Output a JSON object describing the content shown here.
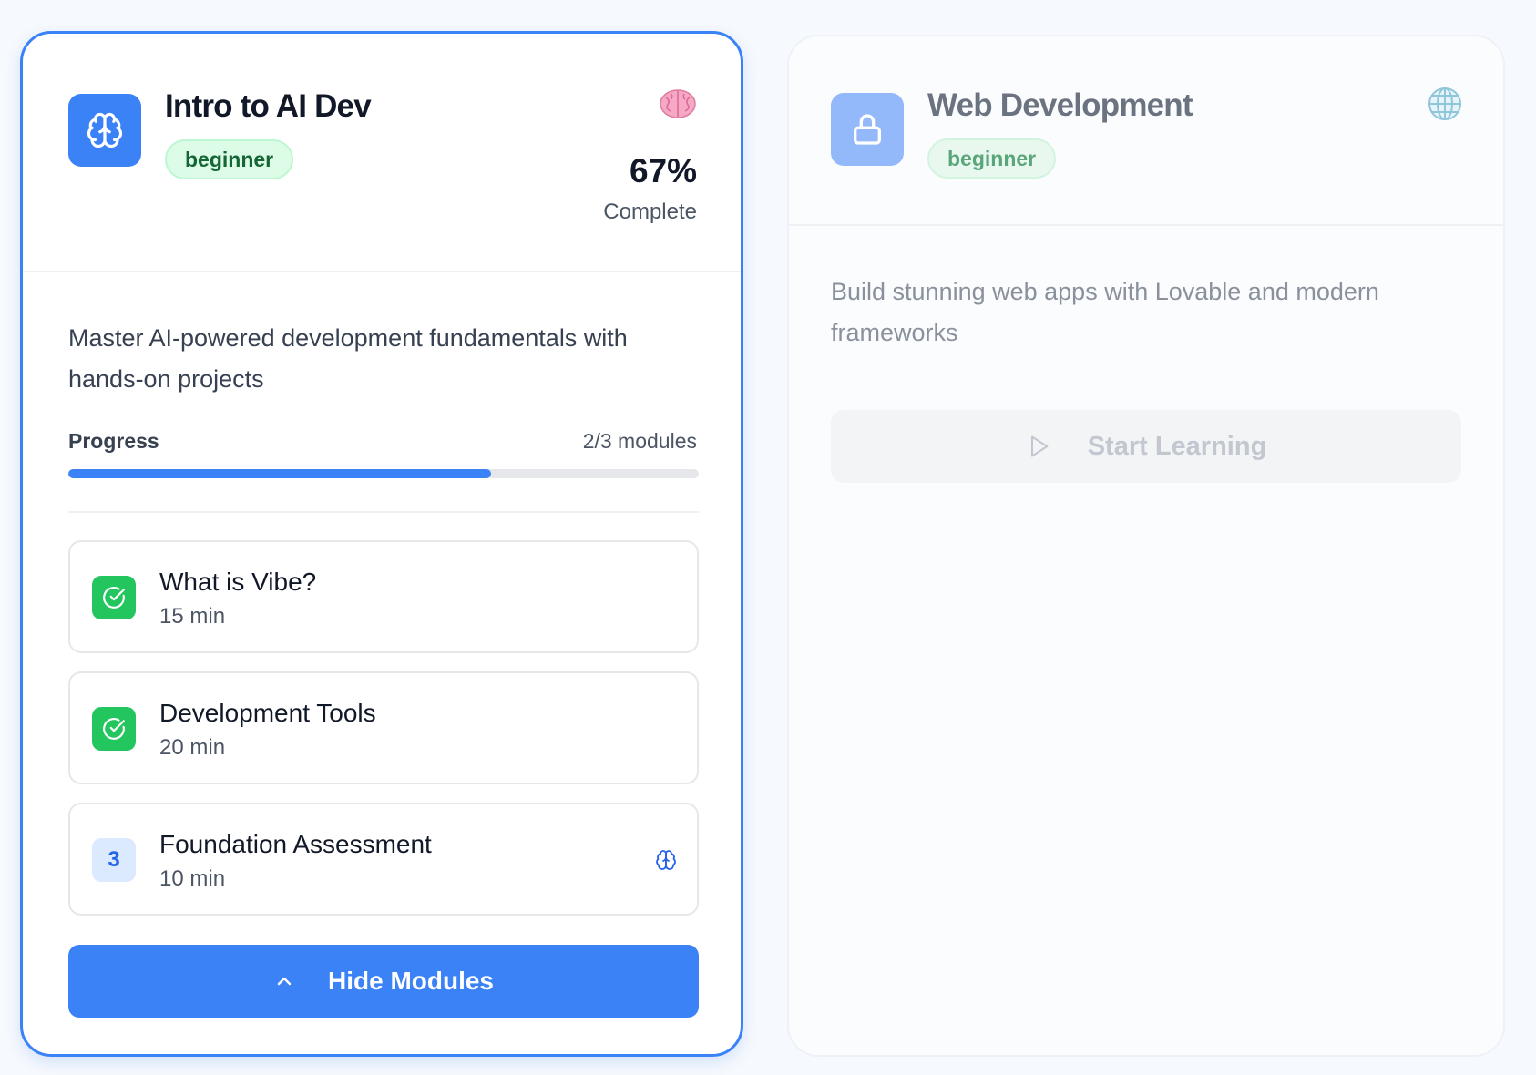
{
  "courses": [
    {
      "title": "Intro to AI Dev",
      "level": "beginner",
      "icon": "brain-icon",
      "emoji": "brain-emoji",
      "progress_percent": "67%",
      "progress_label": "Complete",
      "description": "Master AI-powered development fundamentals with hands-on projects",
      "progress": {
        "label": "Progress",
        "modules_text": "2/3 modules",
        "fraction": 0.67
      },
      "modules": [
        {
          "title": "What is Vibe?",
          "duration": "15 min",
          "status": "completed",
          "status_icon": "check-circle-icon"
        },
        {
          "title": "Development Tools",
          "duration": "20 min",
          "status": "completed",
          "status_icon": "check-circle-icon"
        },
        {
          "number": "3",
          "title": "Foundation Assessment",
          "duration": "10 min",
          "status": "pending",
          "end_icon": "brain-icon"
        }
      ],
      "toggle_button": {
        "label": "Hide Modules",
        "icon": "chevron-up-icon"
      },
      "accent_color": "#3b82f6",
      "selected": true
    },
    {
      "title": "Web Development",
      "level": "beginner",
      "icon": "lock-icon",
      "emoji": "globe-emoji",
      "description": "Build stunning web apps with Lovable and modern frameworks",
      "start_button": {
        "label": "Start Learning",
        "icon": "play-icon",
        "disabled": true
      },
      "locked": true
    }
  ]
}
